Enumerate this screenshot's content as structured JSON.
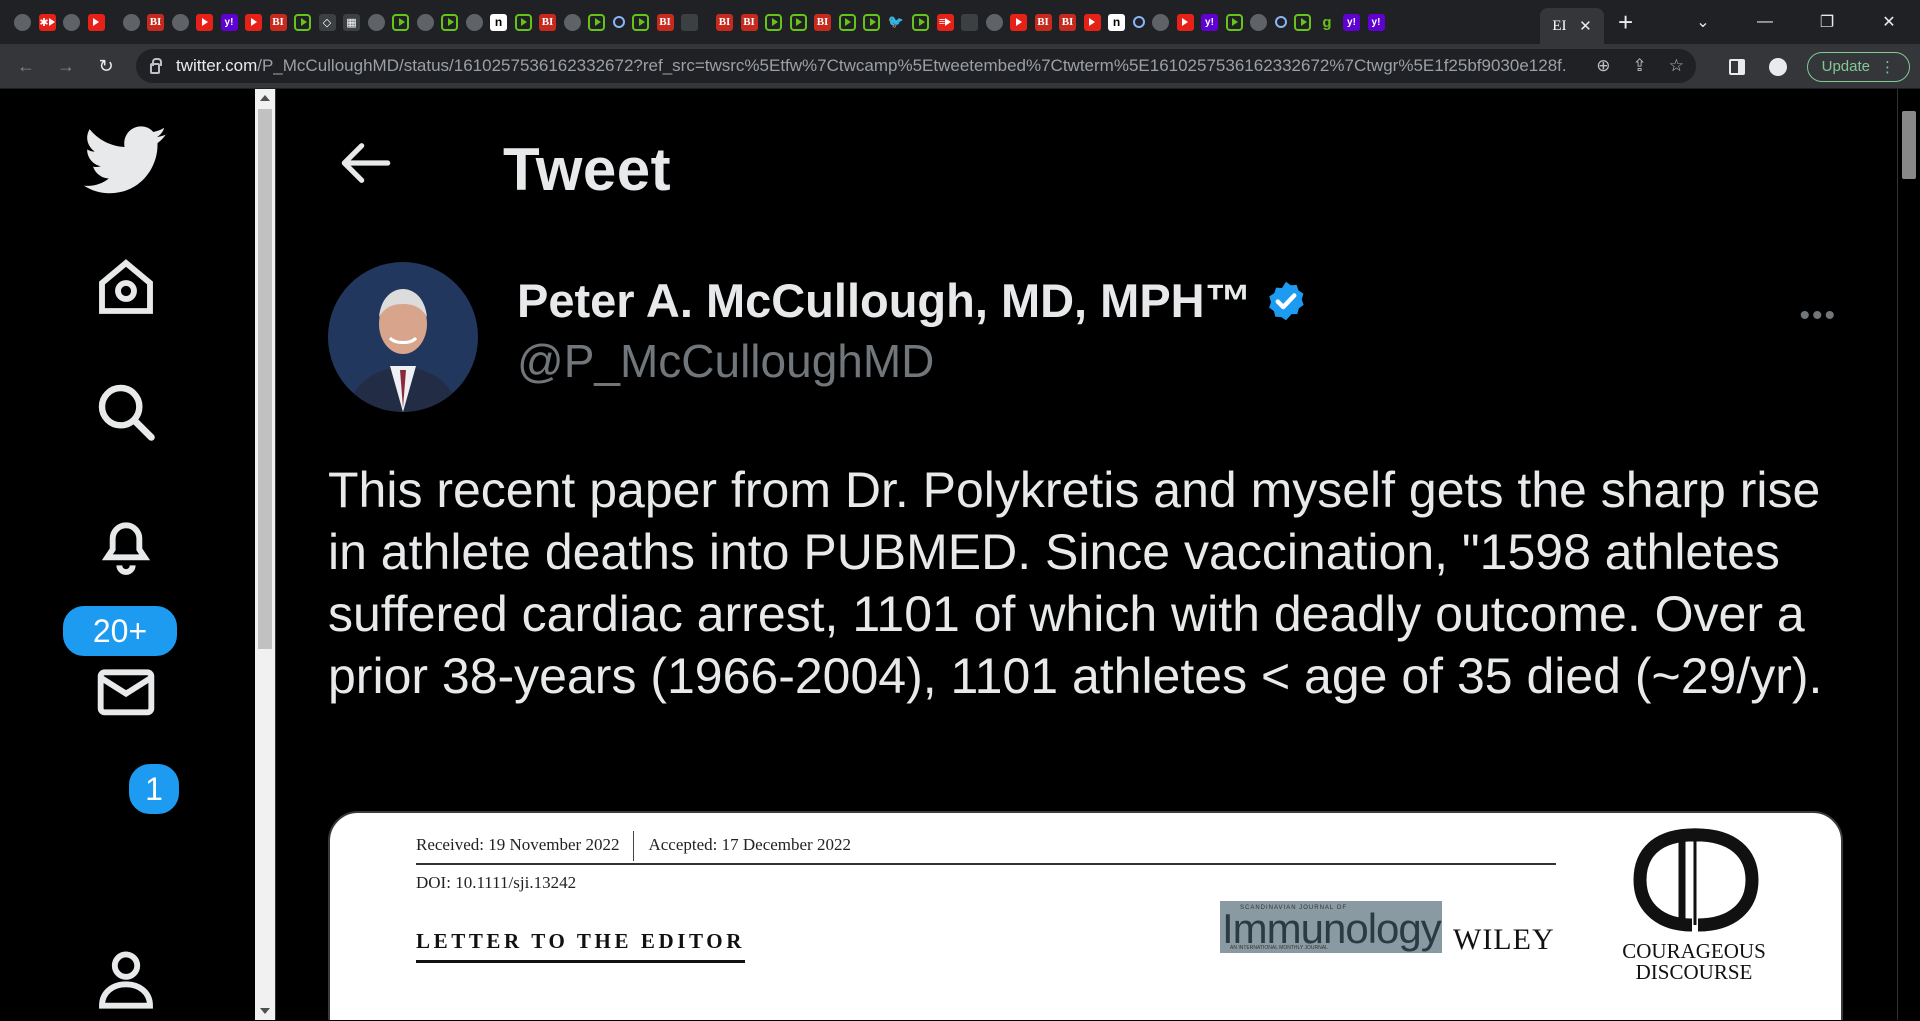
{
  "browser": {
    "url_host": "twitter.com",
    "url_path": "/P_McCulloughMD/status/1610257536162332672?ref_src=twsrc%5Etfw%7Ctwcamp%5Etweetembed%7Ctwterm%5E1610257536162332672%7Ctwgr%5E1f25bf9030e128f...",
    "active_tab_favicon": "EI",
    "update_label": "Update",
    "tab_favicons": [
      "globe-icon",
      "red-star-icon",
      "globe-icon",
      "youtube-icon",
      "gap",
      "globe-icon",
      "bi-icon",
      "globe-icon",
      "youtube-icon",
      "yahoo-icon",
      "youtube-icon",
      "bi-icon",
      "rumble-icon",
      "shield-icon",
      "qr-icon",
      "globe-icon",
      "rumble-icon",
      "globe-icon",
      "rumble-icon",
      "globe-icon",
      "n-icon",
      "rumble-icon",
      "bi-icon",
      "globe-icon",
      "rumble-icon",
      "search-icon",
      "rumble-icon",
      "bi-icon",
      "misc-icon",
      "gap",
      "bi-icon",
      "bi-icon",
      "rumble-icon",
      "rumble-icon",
      "bi-icon",
      "rumble-icon",
      "rumble-icon",
      "twitter-icon",
      "rumble-icon",
      "feed-icon",
      "misc-icon",
      "globe-icon",
      "youtube-icon",
      "bi-icon",
      "bi-icon",
      "youtube-icon",
      "n-icon",
      "search-icon",
      "globe-icon",
      "youtube-icon",
      "yahoo-icon",
      "rumble-icon",
      "globe-icon",
      "search-icon",
      "rumble-icon",
      "g-icon",
      "yahoo-icon",
      "yahoo-icon"
    ]
  },
  "sidebar": {
    "notifications_badge": "20+",
    "messages_badge": "1"
  },
  "header": {
    "title": "Tweet"
  },
  "tweet": {
    "author_name": "Peter A. McCullough, MD, MPH™",
    "author_handle": "@P_McCulloughMD",
    "text": "This recent paper from Dr. Polykretis and myself gets the sharp rise in athlete deaths into PUBMED. Since vaccination, \"1598 athletes suffered cardiac arrest, 1101 of which with deadly outcome. Over a prior 38-years (1966-2004), 1101 athletes < age of 35 died (~29/yr)."
  },
  "media": {
    "received": "Received: 19 November 2022",
    "accepted": "Accepted: 17 December 2022",
    "doi": "DOI: 10.1111/sji.13242",
    "article_type": "LETTER TO THE EDITOR",
    "journal_small": "SCANDINAVIAN JOURNAL OF",
    "journal_name": "Immunology",
    "journal_tagline": "AN INTERNATIONAL MONTHLY JOURNAL",
    "publisher": "WILEY",
    "logo_line1": "COURAGEOUS",
    "logo_line2": "DISCOURSE"
  },
  "colors": {
    "accent": "#1d9bf0",
    "background": "#000000",
    "text": "#e7e9ea",
    "muted": "#71767b"
  }
}
